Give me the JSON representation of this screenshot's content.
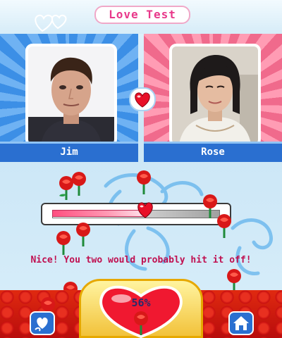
{
  "header": {
    "title": "Love Test"
  },
  "people": [
    {
      "name": "Jim"
    },
    {
      "name": "Rose"
    }
  ],
  "meter": {
    "value_percent": 56
  },
  "result": {
    "percent_label": "56%",
    "message": "Nice! You two would probably hit it off!"
  },
  "colors": {
    "title_pink": "#e8388a",
    "left_panel_blue": "#3c8fe6",
    "right_panel_pink": "#f06a8c",
    "message_red": "#c01050"
  },
  "icons": {
    "left_button": "heart-swirl-icon",
    "right_button": "home-icon"
  }
}
